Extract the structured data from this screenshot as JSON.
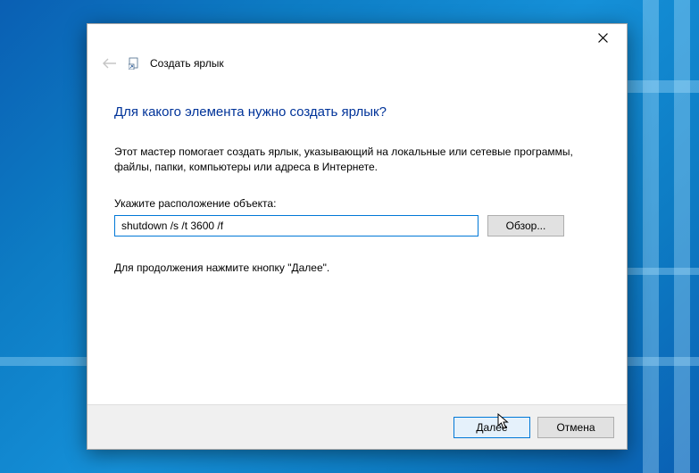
{
  "header": {
    "title": "Создать ярлык"
  },
  "content": {
    "heading": "Для какого элемента нужно создать ярлык?",
    "description": "Этот мастер помогает создать ярлык, указывающий на локальные или сетевые программы, файлы, папки, компьютеры или адреса в Интернете.",
    "location_label": "Укажите расположение объекта:",
    "location_value": "shutdown /s /t 3600 /f",
    "browse_label": "Обзор...",
    "continue_text": "Для продолжения нажмите кнопку \"Далее\"."
  },
  "footer": {
    "next_label": "Далее",
    "cancel_label": "Отмена"
  }
}
